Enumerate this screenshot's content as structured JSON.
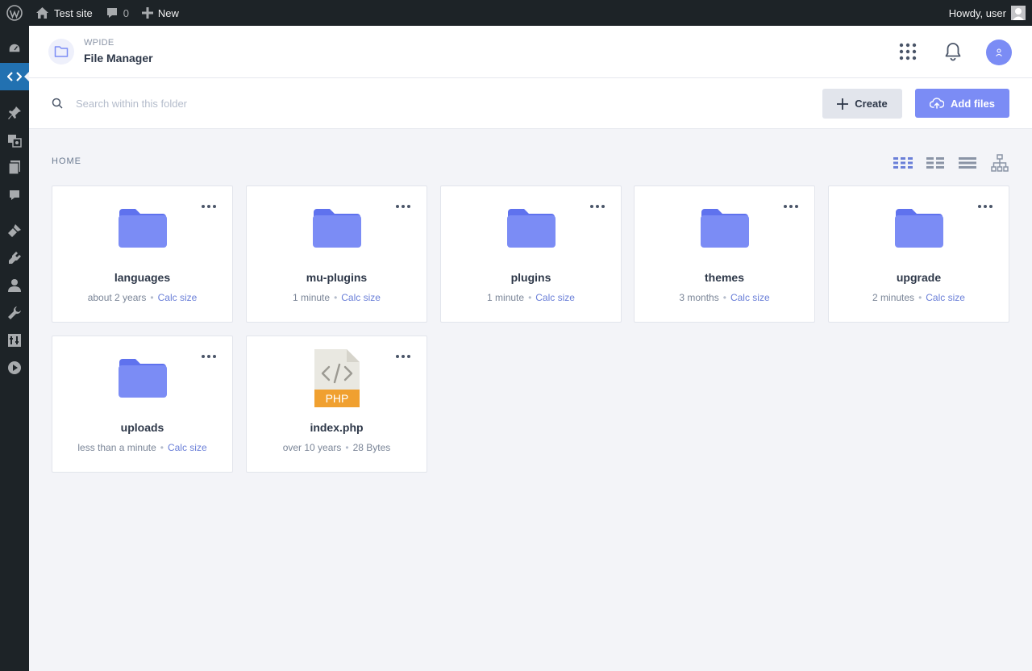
{
  "adminbar": {
    "site_name": "Test site",
    "comments_count": "0",
    "new_label": "New",
    "howdy": "Howdy, user"
  },
  "header": {
    "subtitle": "WPIDE",
    "title": "File Manager"
  },
  "toolbar": {
    "search_placeholder": "Search within this folder",
    "create_label": "Create",
    "add_files_label": "Add files"
  },
  "breadcrumb": "HOME",
  "colors": {
    "accent": "#7b8cf5",
    "folder": "#7b8cf5",
    "wp_active": "#2271b1",
    "php_badge": "#f0a030"
  },
  "items": [
    {
      "name": "languages",
      "modified": "about 2 years",
      "size": "Calc size",
      "type": "folder"
    },
    {
      "name": "mu-plugins",
      "modified": "1 minute",
      "size": "Calc size",
      "type": "folder"
    },
    {
      "name": "plugins",
      "modified": "1 minute",
      "size": "Calc size",
      "type": "folder"
    },
    {
      "name": "themes",
      "modified": "3 months",
      "size": "Calc size",
      "type": "folder"
    },
    {
      "name": "upgrade",
      "modified": "2 minutes",
      "size": "Calc size",
      "type": "folder"
    },
    {
      "name": "uploads",
      "modified": "less than a minute",
      "size": "Calc size",
      "type": "folder"
    },
    {
      "name": "index.php",
      "modified": "over 10 years",
      "size": "28 Bytes",
      "type": "php",
      "badge": "PHP"
    }
  ]
}
